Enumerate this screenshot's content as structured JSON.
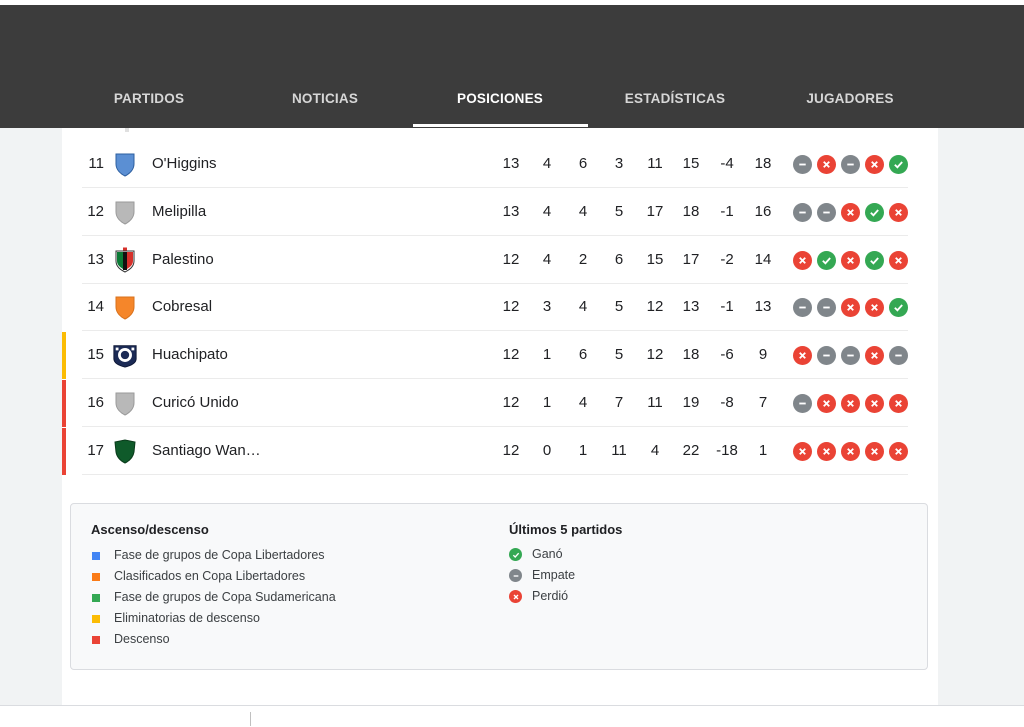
{
  "tabs": [
    {
      "label": "PARTIDOS"
    },
    {
      "label": "NOTICIAS"
    },
    {
      "label": "POSICIONES"
    },
    {
      "label": "ESTADÍSTICAS"
    },
    {
      "label": "JUGADORES"
    }
  ],
  "active_tab": "POSICIONES",
  "rows": [
    {
      "pos": "11",
      "team": "O'Higgins",
      "crest": "ohiggins-crest",
      "zone": "",
      "stats": [
        "13",
        "4",
        "6",
        "3",
        "11",
        "15",
        "-4",
        "18"
      ],
      "last5": [
        "d",
        "l",
        "d",
        "l",
        "w"
      ]
    },
    {
      "pos": "12",
      "team": "Melipilla",
      "crest": "melipilla-crest",
      "zone": "",
      "stats": [
        "13",
        "4",
        "4",
        "5",
        "17",
        "18",
        "-1",
        "16"
      ],
      "last5": [
        "d",
        "d",
        "l",
        "w",
        "l"
      ]
    },
    {
      "pos": "13",
      "team": "Palestino",
      "crest": "palestino-crest",
      "zone": "",
      "stats": [
        "12",
        "4",
        "2",
        "6",
        "15",
        "17",
        "-2",
        "14"
      ],
      "last5": [
        "l",
        "w",
        "l",
        "w",
        "l"
      ]
    },
    {
      "pos": "14",
      "team": "Cobresal",
      "crest": "cobresal-crest",
      "zone": "",
      "stats": [
        "12",
        "3",
        "4",
        "5",
        "12",
        "13",
        "-1",
        "13"
      ],
      "last5": [
        "d",
        "d",
        "l",
        "l",
        "w"
      ]
    },
    {
      "pos": "15",
      "team": "Huachipato",
      "crest": "huachipato-crest",
      "zone": "playoff",
      "stats": [
        "12",
        "1",
        "6",
        "5",
        "12",
        "18",
        "-6",
        "9"
      ],
      "last5": [
        "l",
        "d",
        "d",
        "l",
        "d"
      ]
    },
    {
      "pos": "16",
      "team": "Curicó Unido",
      "crest": "curico-crest",
      "zone": "relegation",
      "stats": [
        "12",
        "1",
        "4",
        "7",
        "11",
        "19",
        "-8",
        "7"
      ],
      "last5": [
        "d",
        "l",
        "l",
        "l",
        "l"
      ]
    },
    {
      "pos": "17",
      "team": "Santiago Wan…",
      "crest": "wanderers-crest",
      "zone": "relegation",
      "stats": [
        "12",
        "0",
        "1",
        "11",
        "4",
        "22",
        "-18",
        "1"
      ],
      "last5": [
        "l",
        "l",
        "l",
        "l",
        "l"
      ]
    }
  ],
  "legend": {
    "zones_title": "Ascenso/descenso",
    "zones": [
      {
        "label": "Fase de grupos de Copa Libertadores",
        "color": "#4285f4"
      },
      {
        "label": "Clasificados en Copa Libertadores",
        "color": "#fa7b17"
      },
      {
        "label": "Fase de grupos de Copa Sudamericana",
        "color": "#34a853"
      },
      {
        "label": "Eliminatorias de descenso",
        "color": "#fbbc04"
      },
      {
        "label": "Descenso",
        "color": "#ea4335"
      }
    ],
    "results_title": "Últimos 5 partidos",
    "results": [
      {
        "label": "Ganó",
        "icon": "check-icon",
        "color": "#34a853"
      },
      {
        "label": "Empate",
        "icon": "minus-icon",
        "color": "#80868b"
      },
      {
        "label": "Perdió",
        "icon": "close-icon",
        "color": "#ea4335"
      }
    ]
  },
  "zone_colors": {
    "playoff": "#fbbc04",
    "relegation": "#ea4335"
  },
  "result_colors": {
    "w": "#34a853",
    "d": "#80868b",
    "l": "#ea4335"
  }
}
